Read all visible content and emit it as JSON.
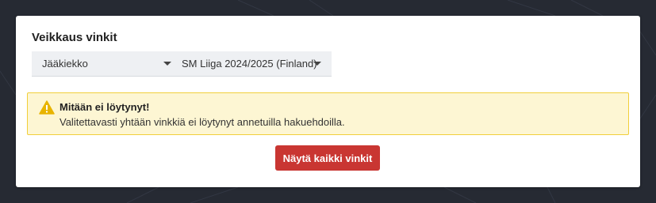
{
  "card": {
    "title": "Veikkaus vinkit"
  },
  "filters": {
    "sport": {
      "selected": "Jääkiekko",
      "icon": "caret-down-icon"
    },
    "league": {
      "selected": "SM Liiga 2024/2025 (Finland)",
      "icon": "caret-down-icon"
    }
  },
  "alert": {
    "icon": "warning-icon",
    "title": "Mitään ei löytynyt!",
    "message": "Valitettavasti yhtään vinkkiä ei löytynyt annetuilla hakuehdoilla."
  },
  "actions": {
    "show_all_label": "Näytä kaikki vinkit"
  },
  "colors": {
    "background": "#262a33",
    "card": "#ffffff",
    "alert_bg": "#fdf6d3",
    "alert_border": "#f1cf3a",
    "warning_icon": "#e8b400",
    "button": "#c93632"
  }
}
